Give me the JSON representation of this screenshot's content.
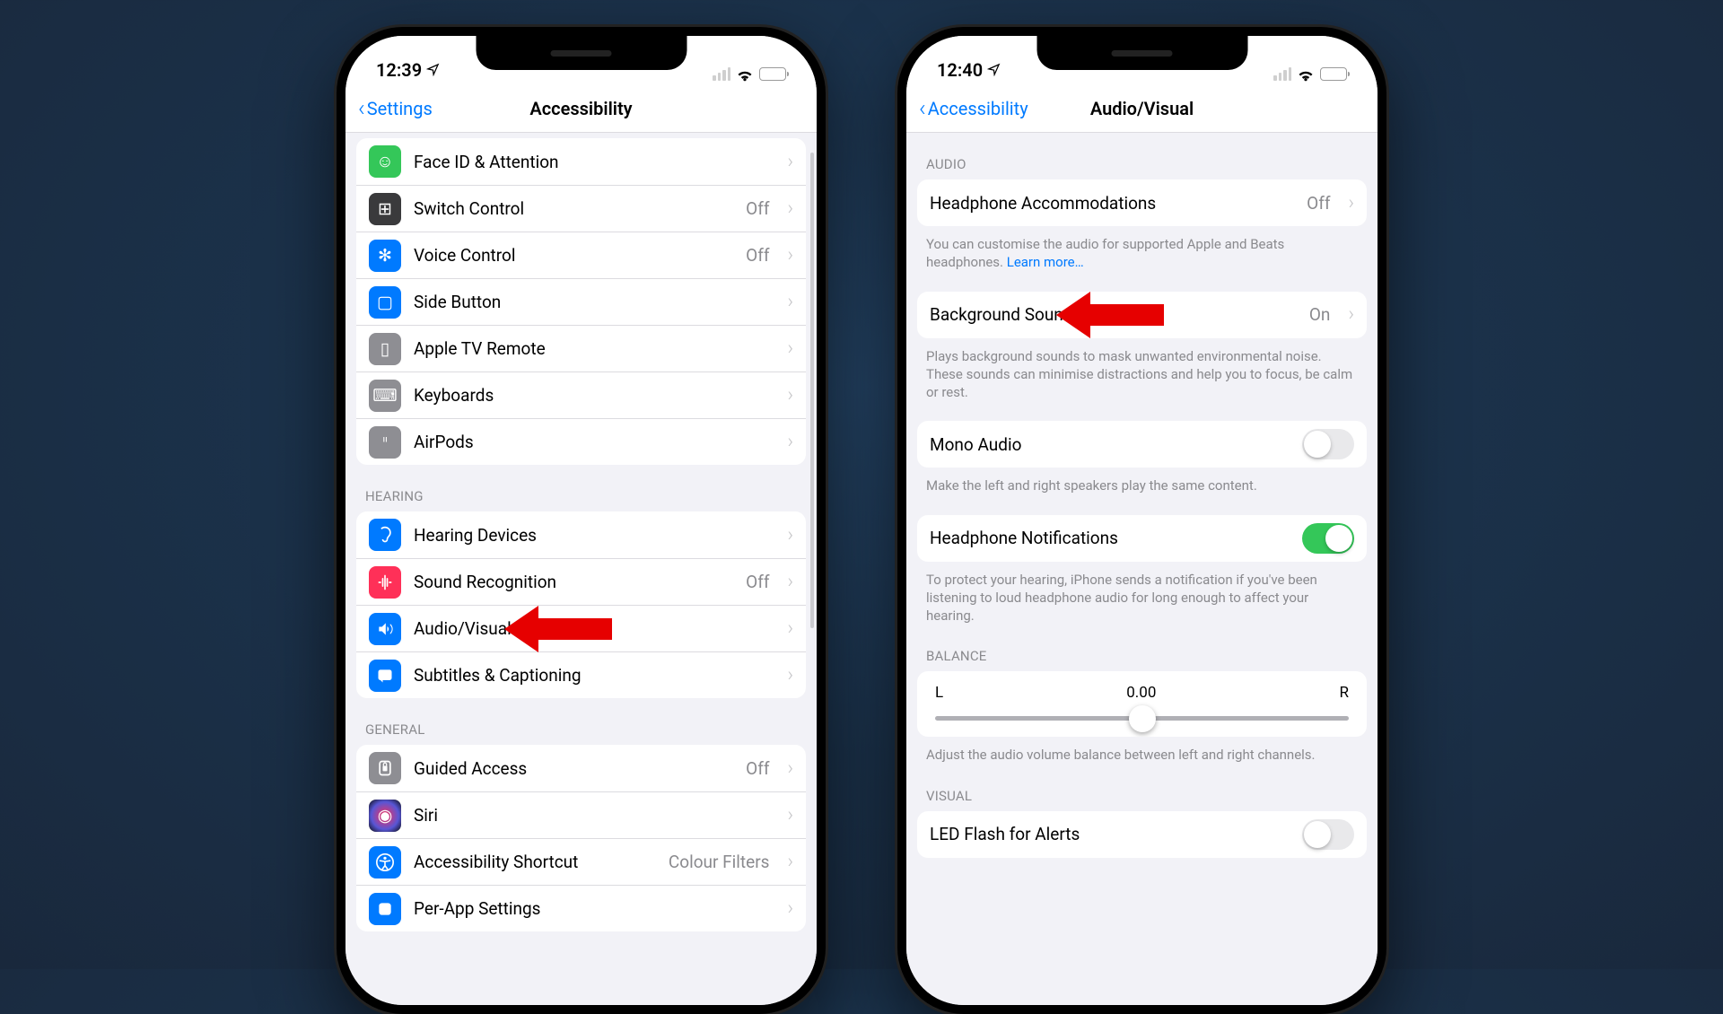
{
  "phoneA": {
    "status": {
      "time": "12:39"
    },
    "nav": {
      "back": "Settings",
      "title": "Accessibility"
    },
    "group1": [
      {
        "icon": "😊",
        "bg": "#34c759",
        "label": "Face ID & Attention",
        "value": "",
        "chev": true
      },
      {
        "icon": "⊞",
        "bg": "#3a3a3c",
        "label": "Switch Control",
        "value": "Off",
        "chev": true
      },
      {
        "icon": "💬",
        "bg": "#007aff",
        "label": "Voice Control",
        "value": "Off",
        "chev": true
      },
      {
        "icon": "⎋",
        "bg": "#007aff",
        "label": "Side Button",
        "value": "",
        "chev": true
      },
      {
        "icon": "▯",
        "bg": "#8e8e93",
        "label": "Apple TV Remote",
        "value": "",
        "chev": true
      },
      {
        "icon": "⌨",
        "bg": "#8e8e93",
        "label": "Keyboards",
        "value": "",
        "chev": true
      },
      {
        "icon": "⊙⊙",
        "bg": "#8e8e93",
        "label": "AirPods",
        "value": "",
        "chev": true
      }
    ],
    "sec_hearing": "HEARING",
    "group_hearing": [
      {
        "icon": "👂",
        "bg": "#007aff",
        "label": "Hearing Devices",
        "value": "",
        "chev": true
      },
      {
        "icon": "∿",
        "bg": "#ff3058",
        "label": "Sound Recognition",
        "value": "Off",
        "chev": true
      },
      {
        "icon": "🔊",
        "bg": "#007aff",
        "label": "Audio/Visual",
        "value": "",
        "chev": true
      },
      {
        "icon": "💬",
        "bg": "#007aff",
        "label": "Subtitles & Captioning",
        "value": "",
        "chev": true
      }
    ],
    "sec_general": "GENERAL",
    "group_general": [
      {
        "icon": "🔒",
        "bg": "#8e8e93",
        "label": "Guided Access",
        "value": "Off",
        "chev": true
      },
      {
        "icon": "◉",
        "bg": "#3a3a3c",
        "label": "Siri",
        "value": "",
        "chev": true
      },
      {
        "icon": "✪",
        "bg": "#007aff",
        "label": "Accessibility Shortcut",
        "value": "Colour Filters",
        "chev": true
      },
      {
        "icon": "⚙",
        "bg": "#007aff",
        "label": "Per-App Settings",
        "value": "",
        "chev": true
      }
    ]
  },
  "phoneB": {
    "status": {
      "time": "12:40"
    },
    "nav": {
      "back": "Accessibility",
      "title": "Audio/Visual"
    },
    "sec_audio": "AUDIO",
    "row_hp_accom": {
      "label": "Headphone Accommodations",
      "value": "Off"
    },
    "foot_hp": "You can customise the audio for supported Apple and Beats headphones. ",
    "foot_hp_link": "Learn more…",
    "row_bg_sounds": {
      "label": "Background Sounds",
      "value": "On"
    },
    "foot_bg": "Plays background sounds to mask unwanted environmental noise. These sounds can minimise distractions and help you to focus, be calm or rest.",
    "row_mono": {
      "label": "Mono Audio",
      "toggle": "off"
    },
    "foot_mono": "Make the left and right speakers play the same content.",
    "row_hp_notif": {
      "label": "Headphone Notifications",
      "toggle": "on"
    },
    "foot_hp_notif": "To protect your hearing, iPhone sends a notification if you've been listening to loud headphone audio for long enough to affect your hearing.",
    "sec_balance": "BALANCE",
    "balance": {
      "L": "L",
      "R": "R",
      "center": "0.00"
    },
    "foot_balance": "Adjust the audio volume balance between left and right channels.",
    "sec_visual": "VISUAL",
    "row_led": {
      "label": "LED Flash for Alerts",
      "toggle": "off"
    }
  }
}
